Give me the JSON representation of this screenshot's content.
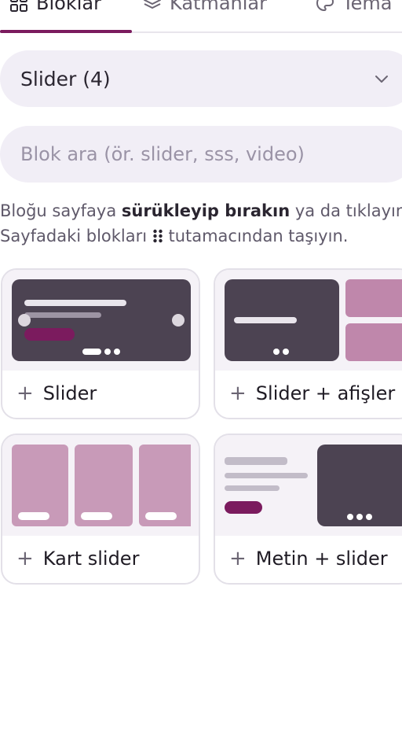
{
  "tabs": [
    {
      "label": "Bloklar",
      "active": true
    },
    {
      "label": "Katmanlar",
      "active": false
    },
    {
      "label": "Tema",
      "active": false
    }
  ],
  "category_select": {
    "value": "Slider (4)"
  },
  "search": {
    "placeholder": "Blok ara (ör. slider, sss, video)"
  },
  "help": {
    "line1_pre": "Bloğu sayfaya ",
    "line1_bold": "sürükleyip bırakın",
    "line1_post": " ya da tıklayın.",
    "line2_pre": "Sayfadaki blokları ",
    "line2_post": " tutamacından taşıyın."
  },
  "blocks": [
    {
      "label": "Slider"
    },
    {
      "label": "Slider + afişler"
    },
    {
      "label": "Kart slider"
    },
    {
      "label": "Metin + slider"
    }
  ],
  "colors": {
    "accent": "#7b1b5e",
    "dark_thumb": "#4c4352",
    "pink_thumb": "#c89ab8"
  }
}
